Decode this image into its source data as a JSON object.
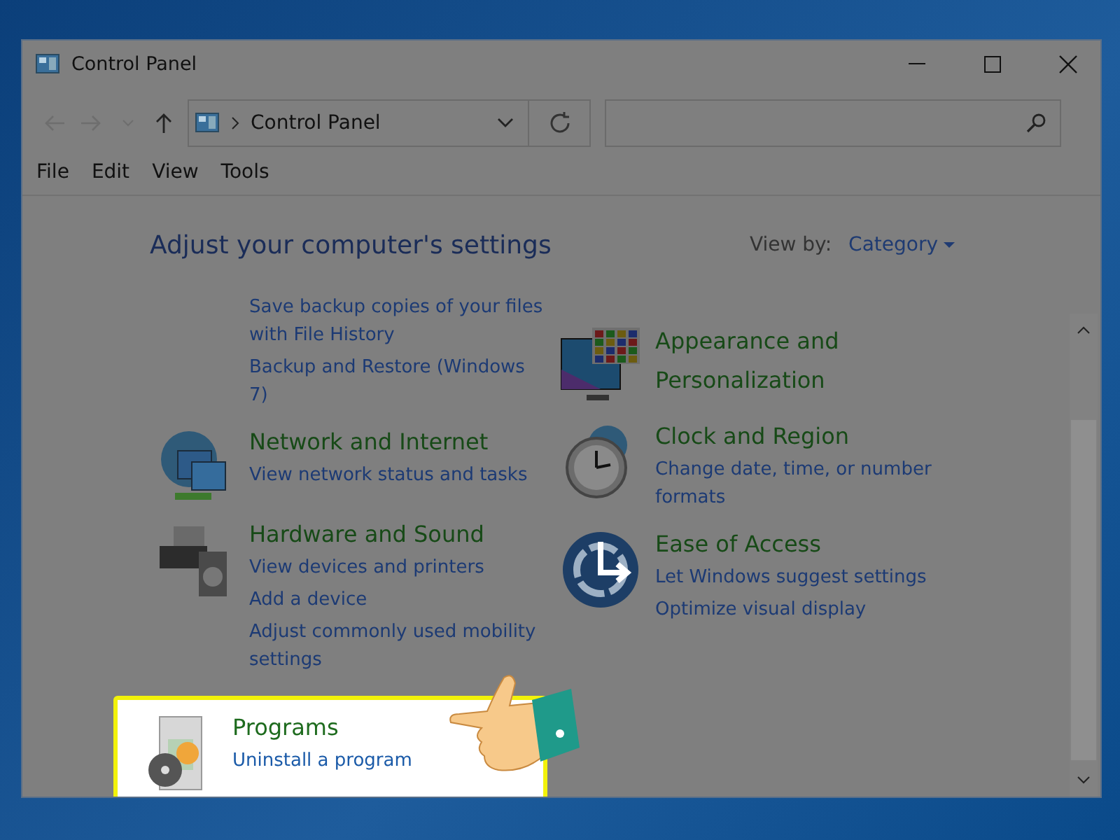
{
  "window": {
    "title": "Control Panel"
  },
  "address_bar": {
    "path": "Control Panel"
  },
  "menu": [
    "File",
    "Edit",
    "View",
    "Tools"
  ],
  "heading": "Adjust your computer's settings",
  "view_by": {
    "label": "View by:",
    "value": "Category"
  },
  "columns": [
    {
      "categories": [
        {
          "highlighted": false,
          "links": [
            "Save backup copies of your files with File History",
            "Backup and Restore (Windows 7)"
          ]
        },
        {
          "title": "Network and Internet",
          "highlighted": false,
          "links": [
            "View network status and tasks"
          ]
        },
        {
          "title": "Hardware and Sound",
          "highlighted": false,
          "links": [
            "View devices and printers",
            "Add a device",
            "Adjust commonly used mobility settings"
          ]
        },
        {
          "title": "Programs",
          "highlighted": true,
          "links": [
            "Uninstall a program"
          ]
        }
      ]
    },
    {
      "categories": [
        {
          "title": "Appearance and Personalization",
          "highlighted": false
        },
        {
          "title": "Clock and Region",
          "highlighted": false,
          "links": [
            "Change date, time, or number formats"
          ]
        },
        {
          "title": "Ease of Access",
          "highlighted": false,
          "links": [
            "Let Windows suggest settings",
            "Optimize visual display"
          ]
        }
      ]
    }
  ]
}
